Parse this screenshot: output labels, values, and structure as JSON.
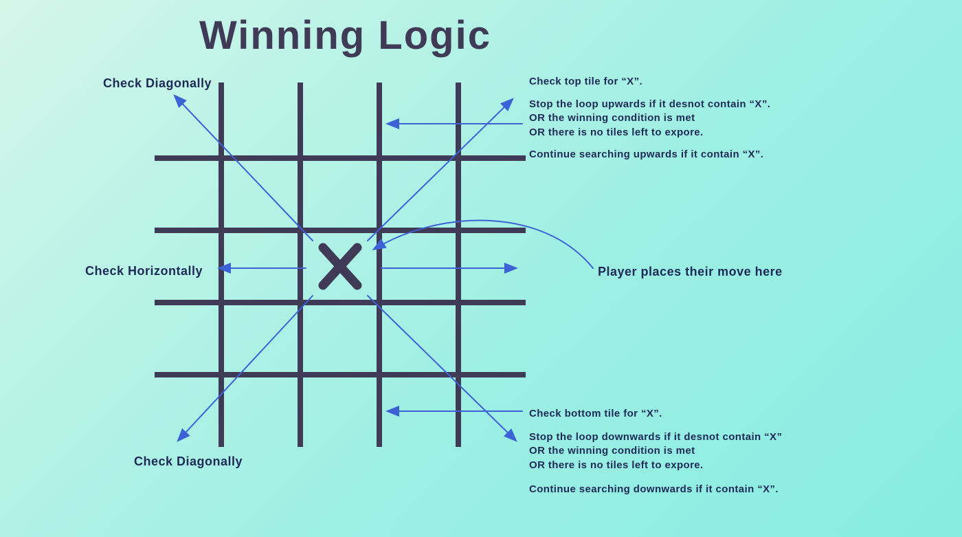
{
  "title": "Winning Logic",
  "labels": {
    "diag_top": "Check Diagonally",
    "diag_bottom": "Check Diagonally",
    "horizontal": "Check Horizontally",
    "player_move": "Player places their move here"
  },
  "top_block": {
    "line1": "Check top tile for “X”.",
    "line2": "Stop the loop upwards if it desnot contain “X”.\nOR the winning condition is met\nOR there is no tiles left to expore.",
    "line3": "Continue searching upwards if it contain “X”."
  },
  "bottom_block": {
    "line1": "Check bottom tile for “X”.",
    "line2": "Stop the loop downwards if it desnot contain “X”\nOR the winning condition is met\nOR there is no tiles left to expore.",
    "line3": "Continue searching downwards if it contain “X”."
  },
  "mark": "X",
  "colors": {
    "text_dark": "#3f3a55",
    "text_navy": "#1d2a55",
    "arrow": "#3d62d6"
  }
}
